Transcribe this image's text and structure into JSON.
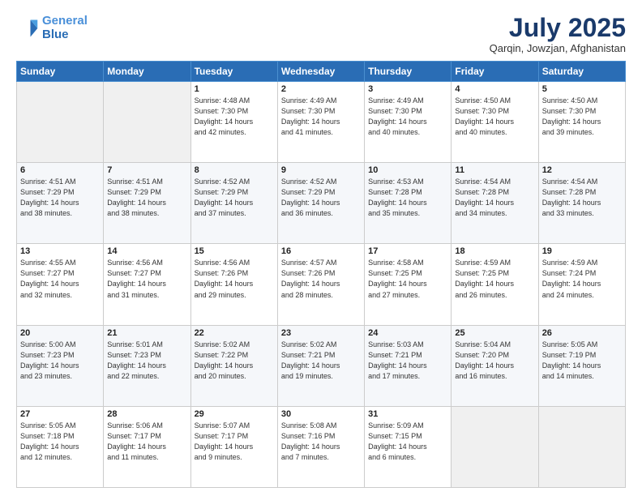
{
  "header": {
    "logo_line1": "General",
    "logo_line2": "Blue",
    "month": "July 2025",
    "location": "Qarqin, Jowzjan, Afghanistan"
  },
  "weekdays": [
    "Sunday",
    "Monday",
    "Tuesday",
    "Wednesday",
    "Thursday",
    "Friday",
    "Saturday"
  ],
  "weeks": [
    [
      {
        "day": "",
        "info": ""
      },
      {
        "day": "",
        "info": ""
      },
      {
        "day": "1",
        "info": "Sunrise: 4:48 AM\nSunset: 7:30 PM\nDaylight: 14 hours\nand 42 minutes."
      },
      {
        "day": "2",
        "info": "Sunrise: 4:49 AM\nSunset: 7:30 PM\nDaylight: 14 hours\nand 41 minutes."
      },
      {
        "day": "3",
        "info": "Sunrise: 4:49 AM\nSunset: 7:30 PM\nDaylight: 14 hours\nand 40 minutes."
      },
      {
        "day": "4",
        "info": "Sunrise: 4:50 AM\nSunset: 7:30 PM\nDaylight: 14 hours\nand 40 minutes."
      },
      {
        "day": "5",
        "info": "Sunrise: 4:50 AM\nSunset: 7:30 PM\nDaylight: 14 hours\nand 39 minutes."
      }
    ],
    [
      {
        "day": "6",
        "info": "Sunrise: 4:51 AM\nSunset: 7:29 PM\nDaylight: 14 hours\nand 38 minutes."
      },
      {
        "day": "7",
        "info": "Sunrise: 4:51 AM\nSunset: 7:29 PM\nDaylight: 14 hours\nand 38 minutes."
      },
      {
        "day": "8",
        "info": "Sunrise: 4:52 AM\nSunset: 7:29 PM\nDaylight: 14 hours\nand 37 minutes."
      },
      {
        "day": "9",
        "info": "Sunrise: 4:52 AM\nSunset: 7:29 PM\nDaylight: 14 hours\nand 36 minutes."
      },
      {
        "day": "10",
        "info": "Sunrise: 4:53 AM\nSunset: 7:28 PM\nDaylight: 14 hours\nand 35 minutes."
      },
      {
        "day": "11",
        "info": "Sunrise: 4:54 AM\nSunset: 7:28 PM\nDaylight: 14 hours\nand 34 minutes."
      },
      {
        "day": "12",
        "info": "Sunrise: 4:54 AM\nSunset: 7:28 PM\nDaylight: 14 hours\nand 33 minutes."
      }
    ],
    [
      {
        "day": "13",
        "info": "Sunrise: 4:55 AM\nSunset: 7:27 PM\nDaylight: 14 hours\nand 32 minutes."
      },
      {
        "day": "14",
        "info": "Sunrise: 4:56 AM\nSunset: 7:27 PM\nDaylight: 14 hours\nand 31 minutes."
      },
      {
        "day": "15",
        "info": "Sunrise: 4:56 AM\nSunset: 7:26 PM\nDaylight: 14 hours\nand 29 minutes."
      },
      {
        "day": "16",
        "info": "Sunrise: 4:57 AM\nSunset: 7:26 PM\nDaylight: 14 hours\nand 28 minutes."
      },
      {
        "day": "17",
        "info": "Sunrise: 4:58 AM\nSunset: 7:25 PM\nDaylight: 14 hours\nand 27 minutes."
      },
      {
        "day": "18",
        "info": "Sunrise: 4:59 AM\nSunset: 7:25 PM\nDaylight: 14 hours\nand 26 minutes."
      },
      {
        "day": "19",
        "info": "Sunrise: 4:59 AM\nSunset: 7:24 PM\nDaylight: 14 hours\nand 24 minutes."
      }
    ],
    [
      {
        "day": "20",
        "info": "Sunrise: 5:00 AM\nSunset: 7:23 PM\nDaylight: 14 hours\nand 23 minutes."
      },
      {
        "day": "21",
        "info": "Sunrise: 5:01 AM\nSunset: 7:23 PM\nDaylight: 14 hours\nand 22 minutes."
      },
      {
        "day": "22",
        "info": "Sunrise: 5:02 AM\nSunset: 7:22 PM\nDaylight: 14 hours\nand 20 minutes."
      },
      {
        "day": "23",
        "info": "Sunrise: 5:02 AM\nSunset: 7:21 PM\nDaylight: 14 hours\nand 19 minutes."
      },
      {
        "day": "24",
        "info": "Sunrise: 5:03 AM\nSunset: 7:21 PM\nDaylight: 14 hours\nand 17 minutes."
      },
      {
        "day": "25",
        "info": "Sunrise: 5:04 AM\nSunset: 7:20 PM\nDaylight: 14 hours\nand 16 minutes."
      },
      {
        "day": "26",
        "info": "Sunrise: 5:05 AM\nSunset: 7:19 PM\nDaylight: 14 hours\nand 14 minutes."
      }
    ],
    [
      {
        "day": "27",
        "info": "Sunrise: 5:05 AM\nSunset: 7:18 PM\nDaylight: 14 hours\nand 12 minutes."
      },
      {
        "day": "28",
        "info": "Sunrise: 5:06 AM\nSunset: 7:17 PM\nDaylight: 14 hours\nand 11 minutes."
      },
      {
        "day": "29",
        "info": "Sunrise: 5:07 AM\nSunset: 7:17 PM\nDaylight: 14 hours\nand 9 minutes."
      },
      {
        "day": "30",
        "info": "Sunrise: 5:08 AM\nSunset: 7:16 PM\nDaylight: 14 hours\nand 7 minutes."
      },
      {
        "day": "31",
        "info": "Sunrise: 5:09 AM\nSunset: 7:15 PM\nDaylight: 14 hours\nand 6 minutes."
      },
      {
        "day": "",
        "info": ""
      },
      {
        "day": "",
        "info": ""
      }
    ]
  ]
}
